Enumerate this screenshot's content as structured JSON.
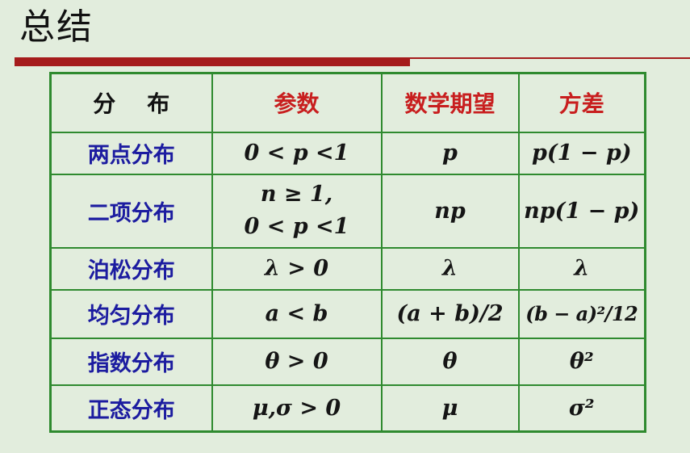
{
  "title": "总结",
  "table": {
    "headers": {
      "distribution": "分    布",
      "params": "参数",
      "expectation": "数学期望",
      "variance": "方差"
    },
    "rows": [
      {
        "name": "两点分布",
        "params": [
          "0 < p <1"
        ],
        "expectation": "p",
        "variance": "p(1 − p)"
      },
      {
        "name": "二项分布",
        "params": [
          "n ≥ 1,",
          "0 < p <1"
        ],
        "expectation": "np",
        "variance": "np(1 − p)"
      },
      {
        "name": "泊松分布",
        "params": [
          "λ > 0"
        ],
        "expectation": "λ",
        "variance": "λ"
      },
      {
        "name": "均匀分布",
        "params": [
          "a < b"
        ],
        "expectation": "(a + b)/2",
        "variance": "(b − a)²/12"
      },
      {
        "name": "指数分布",
        "params": [
          "θ > 0"
        ],
        "expectation": "θ",
        "variance": "θ²"
      },
      {
        "name": "正态分布",
        "params": [
          "μ,σ > 0"
        ],
        "expectation": "μ",
        "variance": "σ²"
      }
    ]
  },
  "colors": {
    "background": "#e2eddd",
    "accent_bar": "#a51c1c",
    "grid": "#2f8a2f",
    "header_red": "#c81e1e",
    "name_blue": "#1c1ca0",
    "text": "#151515"
  }
}
